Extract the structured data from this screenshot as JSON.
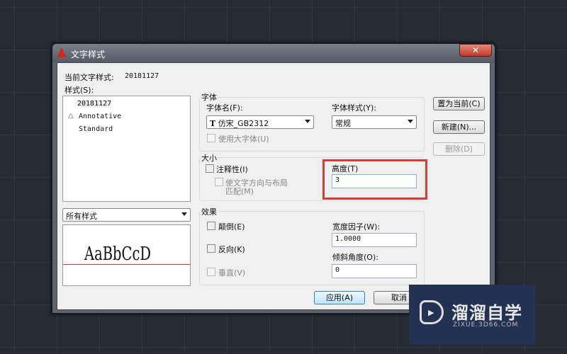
{
  "dialog": {
    "title": "文字样式",
    "close": "✕",
    "current_style_label": "当前文字样式:",
    "current_style_value": "20181127",
    "styles_label": "样式(S):",
    "styles": [
      "20181127",
      "Annotative",
      "Standard"
    ],
    "filter": "所有样式",
    "preview": "AaBbCcD",
    "font_group": "字体",
    "font_name_label": "字体名(F):",
    "font_name": "仿宋_GB2312",
    "font_style_label": "字体样式(Y):",
    "font_style": "常规",
    "big_font": "使用大字体(U)",
    "size_group": "大小",
    "annotative": "注释性(I)",
    "match_layout_1": "使文字方向与布局",
    "match_layout_2": "匹配(M)",
    "height_label": "高度(T)",
    "height_value": "3",
    "effects_group": "效果",
    "upside_down": "颠倒(E)",
    "backwards": "反向(K)",
    "vertical": "垂直(V)",
    "width_factor_label": "宽度因子(W):",
    "width_factor": "1.0000",
    "oblique_label": "倾斜角度(O):",
    "oblique": "0",
    "set_current": "置为当前(C)",
    "new": "新建(N)...",
    "delete": "删除(D)",
    "apply": "应用(A)",
    "cancel": "取消"
  },
  "watermark": {
    "name": "溜溜自学",
    "url": "ZIXUE.3D66.COM"
  },
  "colors": {
    "highlight": "#d0403a",
    "accent": "#233252"
  }
}
